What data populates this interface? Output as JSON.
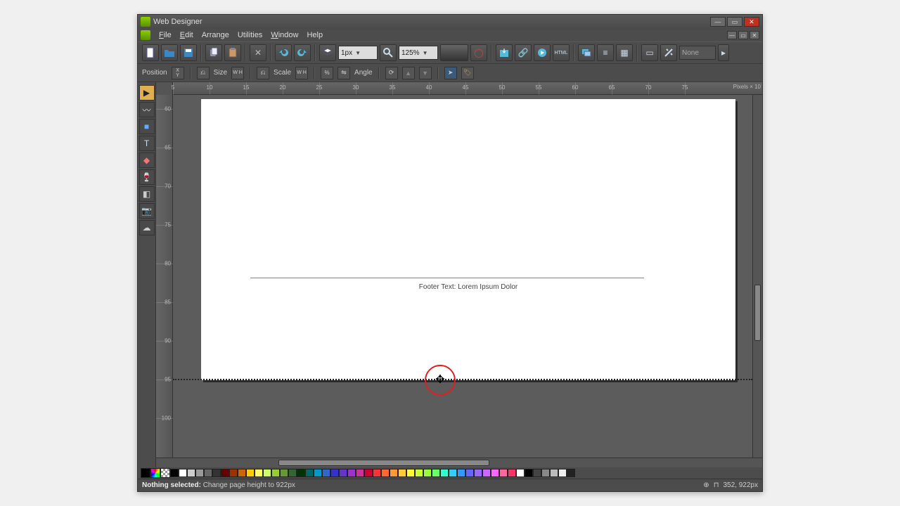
{
  "window": {
    "title": "Web Designer"
  },
  "menu": {
    "file": "File",
    "edit": "Edit",
    "arrange": "Arrange",
    "utilities": "Utilities",
    "window": "Window",
    "help": "Help"
  },
  "toolbar": {
    "stroke": "1px",
    "zoom": "125%",
    "none_label": "None"
  },
  "toolbar2": {
    "position_label": "Position",
    "xy_label": "X\nY",
    "size_label": "Size",
    "scale_label": "Scale",
    "percent_label": "%",
    "angle_label": "Angle"
  },
  "ruler": {
    "h_numbers": [
      "5",
      "10",
      "15",
      "20",
      "25",
      "30",
      "35",
      "40",
      "45",
      "50",
      "55",
      "60",
      "65",
      "70",
      "75"
    ],
    "v_numbers": [
      "60",
      "65",
      "70",
      "75",
      "80",
      "85",
      "90",
      "95",
      "100"
    ],
    "units_label": "Pixels × 10"
  },
  "canvas": {
    "footer_text": "Footer Text: Lorem Ipsum Dolor"
  },
  "palette": {
    "colors": [
      "#000000",
      "#ffffff",
      "#cccccc",
      "#999999",
      "#666666",
      "#333333",
      "#660000",
      "#993300",
      "#cc6600",
      "#ffcc00",
      "#ffff66",
      "#ccff66",
      "#99cc33",
      "#669933",
      "#336633",
      "#003300",
      "#006666",
      "#0099cc",
      "#3366cc",
      "#3333cc",
      "#6633cc",
      "#9933cc",
      "#cc3399",
      "#cc0033",
      "#ff3333",
      "#ff6633",
      "#ff9933",
      "#ffcc33",
      "#ffff33",
      "#ccff33",
      "#99ff33",
      "#66ff66",
      "#33ffcc",
      "#33ccff",
      "#3399ff",
      "#6666ff",
      "#9966ff",
      "#cc66ff",
      "#ff66ff",
      "#ff6699",
      "#ff3366",
      "#ffffff",
      "#000000",
      "#444444",
      "#888888",
      "#bbbbbb",
      "#eeeeee",
      "#222222"
    ]
  },
  "status": {
    "prefix": "Nothing selected:",
    "msg": "Change page height to 922px",
    "coords": "352, 922px"
  }
}
